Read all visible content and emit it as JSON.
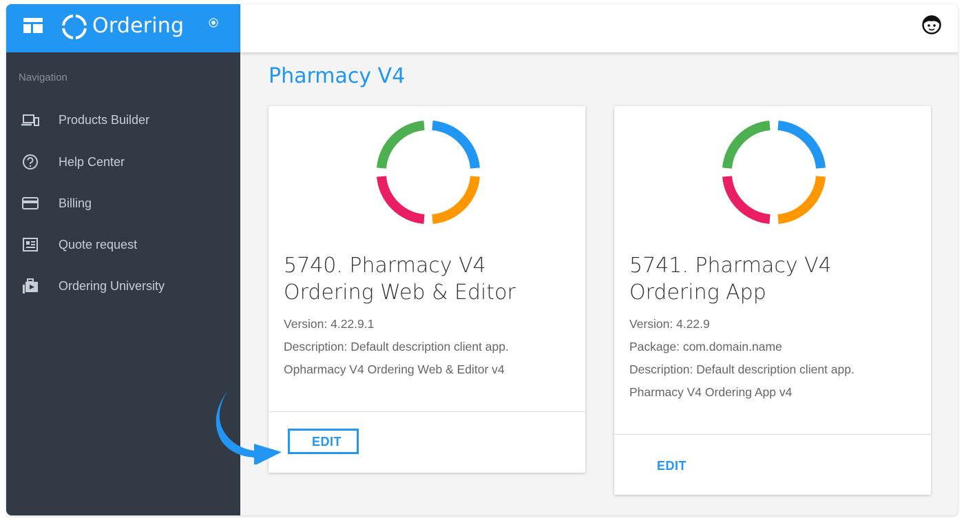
{
  "brand": {
    "name": "Ordering"
  },
  "sidebar": {
    "title": "Navigation",
    "items": [
      {
        "label": "Products Builder",
        "icon": "devices-icon"
      },
      {
        "label": "Help Center",
        "icon": "help-circle-icon"
      },
      {
        "label": "Billing",
        "icon": "credit-card-icon"
      },
      {
        "label": "Quote request",
        "icon": "quote-request-icon"
      },
      {
        "label": "Ordering University",
        "icon": "university-icon"
      }
    ]
  },
  "page": {
    "title": "Pharmacy V4"
  },
  "cards": [
    {
      "title_line1": "5740. Pharmacy V4",
      "title_line2": "Ordering Web & Editor",
      "version": "Version: 4.22.9.1",
      "description": "Description: Default description client app.",
      "name": "Opharmacy V4 Ordering Web & Editor v4",
      "edit_label": "EDIT"
    },
    {
      "title_line1": "5741. Pharmacy V4",
      "title_line2": "Ordering App",
      "version": "Version: 4.22.9",
      "package": "Package: com.domain.name",
      "description": "Description: Default description client app.",
      "name": "Pharmacy V4 Ordering App v4",
      "edit_label": "EDIT"
    }
  ],
  "colors": {
    "accent": "#2196f3",
    "sidebar": "#323a46",
    "logo_green": "#4caf50",
    "logo_blue": "#2196f3",
    "logo_red": "#e91e63",
    "logo_orange": "#ff9800"
  }
}
